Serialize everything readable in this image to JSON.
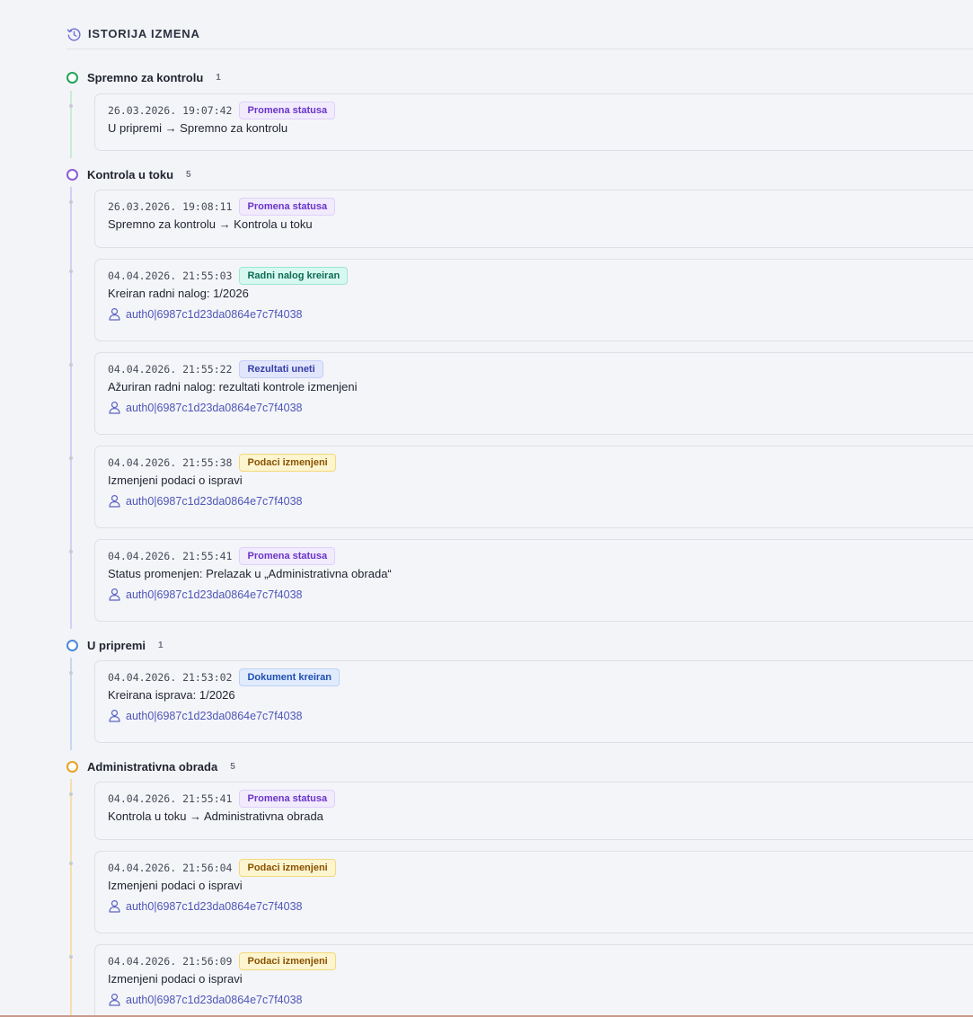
{
  "header": {
    "title": "ISTORIJA IZMENA",
    "icon": "history-icon"
  },
  "groups": [
    {
      "name": "Spremno za kontrolu",
      "count": "1",
      "color": "#22a55a",
      "entries": [
        {
          "timestamp": "26.03.2026. 19:07:42",
          "badge": "Promena statusa",
          "badge_style": "purple",
          "description": "U pripremi → Spremno za kontrolu"
        }
      ]
    },
    {
      "name": "Kontrola u toku",
      "count": "5",
      "color": "#8a5bd6",
      "entries": [
        {
          "timestamp": "26.03.2026. 19:08:11",
          "badge": "Promena statusa",
          "badge_style": "purple",
          "description": "Spremno za kontrolu → Kontrola u toku"
        },
        {
          "timestamp": "04.04.2026. 21:55:03",
          "badge": "Radni nalog kreiran",
          "badge_style": "teal",
          "description": "Kreiran radni nalog: 1/2026",
          "user": "auth0|6987c1d23da0864e7c7f4038"
        },
        {
          "timestamp": "04.04.2026. 21:55:22",
          "badge": "Rezultati uneti",
          "badge_style": "indigo",
          "description": "Ažuriran radni nalog: rezultati kontrole izmenjeni",
          "user": "auth0|6987c1d23da0864e7c7f4038"
        },
        {
          "timestamp": "04.04.2026. 21:55:38",
          "badge": "Podaci izmenjeni",
          "badge_style": "yellow",
          "description": "Izmenjeni podaci o ispravi",
          "user": "auth0|6987c1d23da0864e7c7f4038"
        },
        {
          "timestamp": "04.04.2026. 21:55:41",
          "badge": "Promena statusa",
          "badge_style": "purple",
          "description": "Status promenjen: Prelazak u „Administrativna obrada“",
          "user": "auth0|6987c1d23da0864e7c7f4038"
        }
      ]
    },
    {
      "name": "U pripremi",
      "count": "1",
      "color": "#4a8ad8",
      "entries": [
        {
          "timestamp": "04.04.2026. 21:53:02",
          "badge": "Dokument kreiran",
          "badge_style": "blue",
          "description": "Kreirana isprava: 1/2026",
          "user": "auth0|6987c1d23da0864e7c7f4038"
        }
      ]
    },
    {
      "name": "Administrativna obrada",
      "count": "5",
      "color": "#e6a322",
      "entries": [
        {
          "timestamp": "04.04.2026. 21:55:41",
          "badge": "Promena statusa",
          "badge_style": "purple",
          "description": "Kontrola u toku → Administrativna obrada"
        },
        {
          "timestamp": "04.04.2026. 21:56:04",
          "badge": "Podaci izmenjeni",
          "badge_style": "yellow",
          "description": "Izmenjeni podaci o ispravi",
          "user": "auth0|6987c1d23da0864e7c7f4038"
        },
        {
          "timestamp": "04.04.2026. 21:56:09",
          "badge": "Podaci izmenjeni",
          "badge_style": "yellow",
          "description": "Izmenjeni podaci o ispravi",
          "user": "auth0|6987c1d23da0864e7c7f4038"
        }
      ]
    }
  ],
  "rail_colors": [
    "#c9ecd5",
    "#d9cdf5",
    "#c6d9f3",
    "#f4dfae"
  ]
}
